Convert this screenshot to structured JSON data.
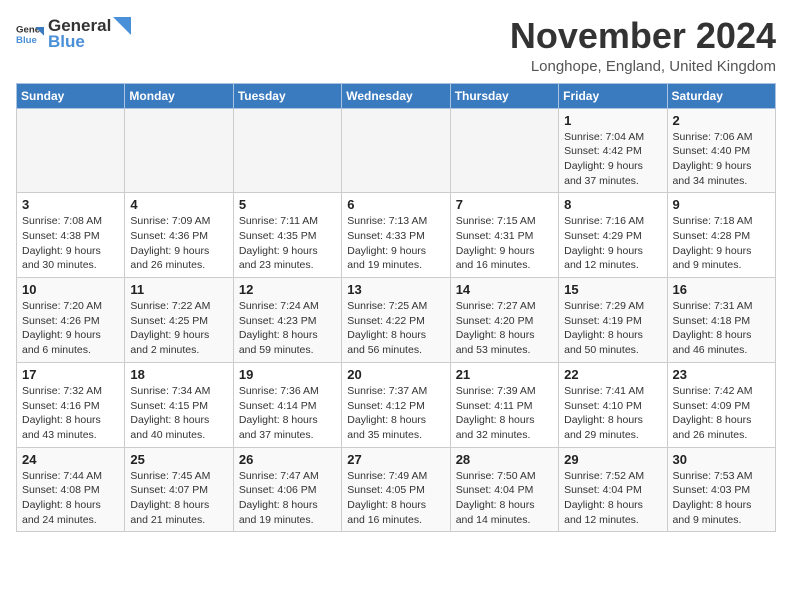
{
  "header": {
    "logo_general": "General",
    "logo_blue": "Blue",
    "title": "November 2024",
    "location": "Longhope, England, United Kingdom"
  },
  "weekdays": [
    "Sunday",
    "Monday",
    "Tuesday",
    "Wednesday",
    "Thursday",
    "Friday",
    "Saturday"
  ],
  "weeks": [
    [
      {
        "day": "",
        "info": ""
      },
      {
        "day": "",
        "info": ""
      },
      {
        "day": "",
        "info": ""
      },
      {
        "day": "",
        "info": ""
      },
      {
        "day": "",
        "info": ""
      },
      {
        "day": "1",
        "info": "Sunrise: 7:04 AM\nSunset: 4:42 PM\nDaylight: 9 hours and 37 minutes."
      },
      {
        "day": "2",
        "info": "Sunrise: 7:06 AM\nSunset: 4:40 PM\nDaylight: 9 hours and 34 minutes."
      }
    ],
    [
      {
        "day": "3",
        "info": "Sunrise: 7:08 AM\nSunset: 4:38 PM\nDaylight: 9 hours and 30 minutes."
      },
      {
        "day": "4",
        "info": "Sunrise: 7:09 AM\nSunset: 4:36 PM\nDaylight: 9 hours and 26 minutes."
      },
      {
        "day": "5",
        "info": "Sunrise: 7:11 AM\nSunset: 4:35 PM\nDaylight: 9 hours and 23 minutes."
      },
      {
        "day": "6",
        "info": "Sunrise: 7:13 AM\nSunset: 4:33 PM\nDaylight: 9 hours and 19 minutes."
      },
      {
        "day": "7",
        "info": "Sunrise: 7:15 AM\nSunset: 4:31 PM\nDaylight: 9 hours and 16 minutes."
      },
      {
        "day": "8",
        "info": "Sunrise: 7:16 AM\nSunset: 4:29 PM\nDaylight: 9 hours and 12 minutes."
      },
      {
        "day": "9",
        "info": "Sunrise: 7:18 AM\nSunset: 4:28 PM\nDaylight: 9 hours and 9 minutes."
      }
    ],
    [
      {
        "day": "10",
        "info": "Sunrise: 7:20 AM\nSunset: 4:26 PM\nDaylight: 9 hours and 6 minutes."
      },
      {
        "day": "11",
        "info": "Sunrise: 7:22 AM\nSunset: 4:25 PM\nDaylight: 9 hours and 2 minutes."
      },
      {
        "day": "12",
        "info": "Sunrise: 7:24 AM\nSunset: 4:23 PM\nDaylight: 8 hours and 59 minutes."
      },
      {
        "day": "13",
        "info": "Sunrise: 7:25 AM\nSunset: 4:22 PM\nDaylight: 8 hours and 56 minutes."
      },
      {
        "day": "14",
        "info": "Sunrise: 7:27 AM\nSunset: 4:20 PM\nDaylight: 8 hours and 53 minutes."
      },
      {
        "day": "15",
        "info": "Sunrise: 7:29 AM\nSunset: 4:19 PM\nDaylight: 8 hours and 50 minutes."
      },
      {
        "day": "16",
        "info": "Sunrise: 7:31 AM\nSunset: 4:18 PM\nDaylight: 8 hours and 46 minutes."
      }
    ],
    [
      {
        "day": "17",
        "info": "Sunrise: 7:32 AM\nSunset: 4:16 PM\nDaylight: 8 hours and 43 minutes."
      },
      {
        "day": "18",
        "info": "Sunrise: 7:34 AM\nSunset: 4:15 PM\nDaylight: 8 hours and 40 minutes."
      },
      {
        "day": "19",
        "info": "Sunrise: 7:36 AM\nSunset: 4:14 PM\nDaylight: 8 hours and 37 minutes."
      },
      {
        "day": "20",
        "info": "Sunrise: 7:37 AM\nSunset: 4:12 PM\nDaylight: 8 hours and 35 minutes."
      },
      {
        "day": "21",
        "info": "Sunrise: 7:39 AM\nSunset: 4:11 PM\nDaylight: 8 hours and 32 minutes."
      },
      {
        "day": "22",
        "info": "Sunrise: 7:41 AM\nSunset: 4:10 PM\nDaylight: 8 hours and 29 minutes."
      },
      {
        "day": "23",
        "info": "Sunrise: 7:42 AM\nSunset: 4:09 PM\nDaylight: 8 hours and 26 minutes."
      }
    ],
    [
      {
        "day": "24",
        "info": "Sunrise: 7:44 AM\nSunset: 4:08 PM\nDaylight: 8 hours and 24 minutes."
      },
      {
        "day": "25",
        "info": "Sunrise: 7:45 AM\nSunset: 4:07 PM\nDaylight: 8 hours and 21 minutes."
      },
      {
        "day": "26",
        "info": "Sunrise: 7:47 AM\nSunset: 4:06 PM\nDaylight: 8 hours and 19 minutes."
      },
      {
        "day": "27",
        "info": "Sunrise: 7:49 AM\nSunset: 4:05 PM\nDaylight: 8 hours and 16 minutes."
      },
      {
        "day": "28",
        "info": "Sunrise: 7:50 AM\nSunset: 4:04 PM\nDaylight: 8 hours and 14 minutes."
      },
      {
        "day": "29",
        "info": "Sunrise: 7:52 AM\nSunset: 4:04 PM\nDaylight: 8 hours and 12 minutes."
      },
      {
        "day": "30",
        "info": "Sunrise: 7:53 AM\nSunset: 4:03 PM\nDaylight: 8 hours and 9 minutes."
      }
    ]
  ]
}
